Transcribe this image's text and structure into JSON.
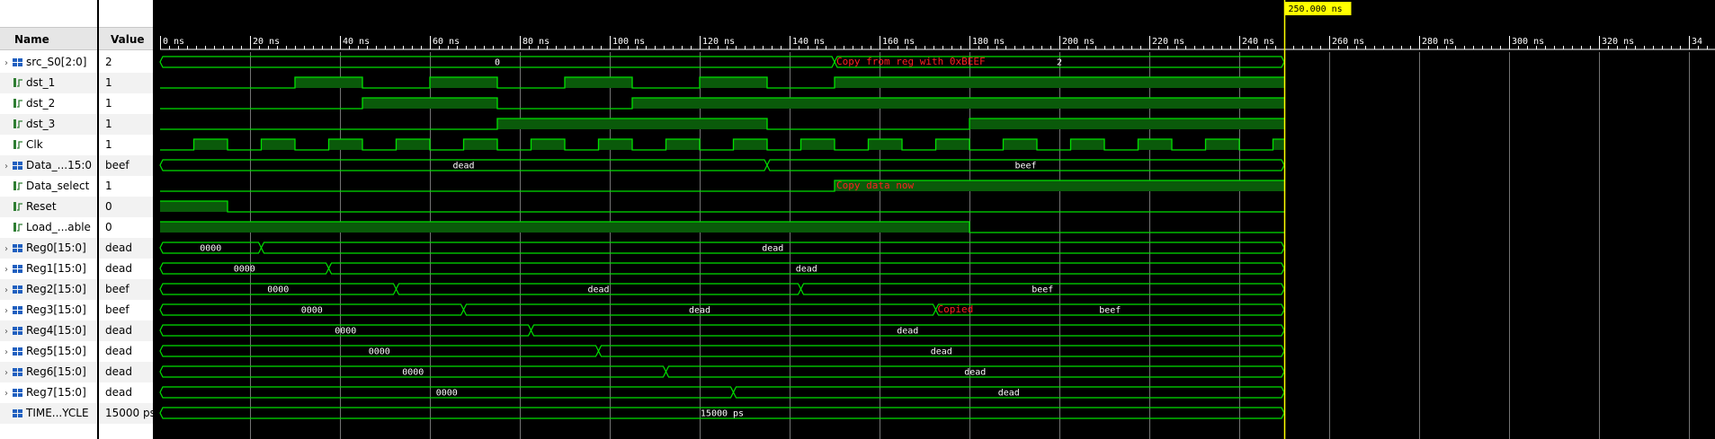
{
  "columns": {
    "name": "Name",
    "value": "Value"
  },
  "cursor_label": "250.000 ns",
  "ruler_ticks": [
    "0 ns",
    "20 ns",
    "40 ns",
    "60 ns",
    "80 ns",
    "100 ns",
    "120 ns",
    "140 ns",
    "160 ns",
    "180 ns",
    "200 ns",
    "220 ns",
    "240 ns",
    "260 ns",
    "280 ns",
    "300 ns",
    "320 ns",
    "34"
  ],
  "colors": {
    "wave": "#00e000",
    "fill": "#0a5a0a",
    "grid": "#ffffff",
    "cursor": "#ffff00",
    "annotation": "#ff2020"
  },
  "signals": [
    {
      "name": "src_S0[2:0]",
      "value": "2",
      "type": "bus",
      "expandable": true,
      "segments": [
        {
          "from": 0,
          "to": 150,
          "label": "0"
        },
        {
          "from": 150,
          "to": 250,
          "label": "2"
        }
      ]
    },
    {
      "name": "dst_1",
      "value": "1",
      "type": "bit",
      "initial": 0,
      "toggles": [
        30,
        45,
        60,
        75,
        90,
        105,
        120,
        135,
        150
      ]
    },
    {
      "name": "dst_2",
      "value": "1",
      "type": "bit",
      "initial": 0,
      "toggles": [
        45,
        75,
        105
      ]
    },
    {
      "name": "dst_3",
      "value": "1",
      "type": "bit",
      "initial": 0,
      "toggles": [
        75,
        135,
        180
      ]
    },
    {
      "name": "Clk",
      "value": "1",
      "type": "clock",
      "period": 15,
      "high_first": 7.5,
      "high_len": 7.5
    },
    {
      "name": "Data_...15:0",
      "value": "beef",
      "type": "bus",
      "expandable": true,
      "segments": [
        {
          "from": 0,
          "to": 135,
          "label": "dead"
        },
        {
          "from": 135,
          "to": 250,
          "label": "beef"
        }
      ]
    },
    {
      "name": "Data_select",
      "value": "1",
      "type": "bit",
      "initial": 0,
      "toggles": [
        150
      ]
    },
    {
      "name": "Reset",
      "value": "0",
      "type": "bit",
      "initial": 1,
      "toggles": [
        15
      ]
    },
    {
      "name": "Load_...able",
      "value": "0",
      "type": "bit",
      "initial": 1,
      "toggles": [
        180
      ]
    },
    {
      "name": "Reg0[15:0]",
      "value": "dead",
      "type": "bus",
      "expandable": true,
      "segments": [
        {
          "from": 0,
          "to": 22.5,
          "label": "0000"
        },
        {
          "from": 22.5,
          "to": 250,
          "label": "dead"
        }
      ]
    },
    {
      "name": "Reg1[15:0]",
      "value": "dead",
      "type": "bus",
      "expandable": true,
      "segments": [
        {
          "from": 0,
          "to": 37.5,
          "label": "0000"
        },
        {
          "from": 37.5,
          "to": 250,
          "label": "dead"
        }
      ]
    },
    {
      "name": "Reg2[15:0]",
      "value": "beef",
      "type": "bus",
      "expandable": true,
      "segments": [
        {
          "from": 0,
          "to": 52.5,
          "label": "0000"
        },
        {
          "from": 52.5,
          "to": 142.5,
          "label": "dead"
        },
        {
          "from": 142.5,
          "to": 250,
          "label": "beef"
        }
      ]
    },
    {
      "name": "Reg3[15:0]",
      "value": "beef",
      "type": "bus",
      "expandable": true,
      "segments": [
        {
          "from": 0,
          "to": 67.5,
          "label": "0000"
        },
        {
          "from": 67.5,
          "to": 172.5,
          "label": "dead"
        },
        {
          "from": 172.5,
          "to": 250,
          "label": "beef"
        }
      ]
    },
    {
      "name": "Reg4[15:0]",
      "value": "dead",
      "type": "bus",
      "expandable": true,
      "segments": [
        {
          "from": 0,
          "to": 82.5,
          "label": "0000"
        },
        {
          "from": 82.5,
          "to": 250,
          "label": "dead"
        }
      ]
    },
    {
      "name": "Reg5[15:0]",
      "value": "dead",
      "type": "bus",
      "expandable": true,
      "segments": [
        {
          "from": 0,
          "to": 97.5,
          "label": "0000"
        },
        {
          "from": 97.5,
          "to": 250,
          "label": "dead"
        }
      ]
    },
    {
      "name": "Reg6[15:0]",
      "value": "dead",
      "type": "bus",
      "expandable": true,
      "segments": [
        {
          "from": 0,
          "to": 112.5,
          "label": "0000"
        },
        {
          "from": 112.5,
          "to": 250,
          "label": "dead"
        }
      ]
    },
    {
      "name": "Reg7[15:0]",
      "value": "dead",
      "type": "bus",
      "expandable": true,
      "segments": [
        {
          "from": 0,
          "to": 127.5,
          "label": "0000"
        },
        {
          "from": 127.5,
          "to": 250,
          "label": "dead"
        }
      ]
    },
    {
      "name": "TIME...YCLE",
      "value": "15000 ps",
      "type": "bus",
      "expandable": false,
      "segments": [
        {
          "from": 0,
          "to": 250,
          "label": "15000 ps"
        }
      ]
    }
  ],
  "annotations": [
    {
      "signal": 0,
      "time": 150,
      "text": "Copy from reg with 0xBEEF"
    },
    {
      "signal": 6,
      "time": 150,
      "text": "Copy data now"
    },
    {
      "signal": 12,
      "time": 172.5,
      "text": "Copied"
    }
  ]
}
